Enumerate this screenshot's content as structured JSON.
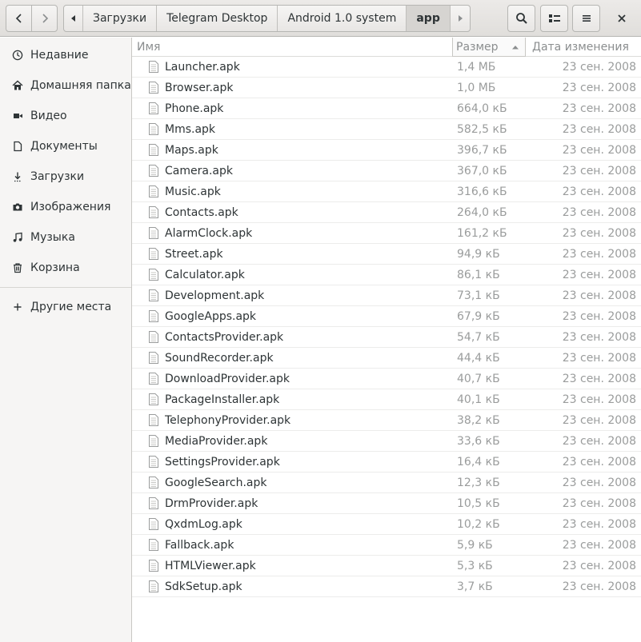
{
  "breadcrumbs": [
    "Загрузки",
    "Telegram Desktop",
    "Android 1.0 system",
    "app"
  ],
  "sidebar": {
    "items": [
      {
        "label": "Недавние",
        "icon": "clock-icon"
      },
      {
        "label": "Домашняя папка",
        "icon": "home-icon"
      },
      {
        "label": "Видео",
        "icon": "video-icon"
      },
      {
        "label": "Документы",
        "icon": "document-icon"
      },
      {
        "label": "Загрузки",
        "icon": "download-icon"
      },
      {
        "label": "Изображения",
        "icon": "camera-icon"
      },
      {
        "label": "Музыка",
        "icon": "music-icon"
      },
      {
        "label": "Корзина",
        "icon": "trash-icon"
      }
    ],
    "other": {
      "label": "Другие места",
      "icon": "plus-icon"
    }
  },
  "columns": {
    "name": "Имя",
    "size": "Размер",
    "date": "Дата изменения"
  },
  "files": [
    {
      "name": "Launcher.apk",
      "size": "1,4 МБ",
      "date": "23 сен. 2008"
    },
    {
      "name": "Browser.apk",
      "size": "1,0 МБ",
      "date": "23 сен. 2008"
    },
    {
      "name": "Phone.apk",
      "size": "664,0 кБ",
      "date": "23 сен. 2008"
    },
    {
      "name": "Mms.apk",
      "size": "582,5 кБ",
      "date": "23 сен. 2008"
    },
    {
      "name": "Maps.apk",
      "size": "396,7 кБ",
      "date": "23 сен. 2008"
    },
    {
      "name": "Camera.apk",
      "size": "367,0 кБ",
      "date": "23 сен. 2008"
    },
    {
      "name": "Music.apk",
      "size": "316,6 кБ",
      "date": "23 сен. 2008"
    },
    {
      "name": "Contacts.apk",
      "size": "264,0 кБ",
      "date": "23 сен. 2008"
    },
    {
      "name": "AlarmClock.apk",
      "size": "161,2 кБ",
      "date": "23 сен. 2008"
    },
    {
      "name": "Street.apk",
      "size": "94,9 кБ",
      "date": "23 сен. 2008"
    },
    {
      "name": "Calculator.apk",
      "size": "86,1 кБ",
      "date": "23 сен. 2008"
    },
    {
      "name": "Development.apk",
      "size": "73,1 кБ",
      "date": "23 сен. 2008"
    },
    {
      "name": "GoogleApps.apk",
      "size": "67,9 кБ",
      "date": "23 сен. 2008"
    },
    {
      "name": "ContactsProvider.apk",
      "size": "54,7 кБ",
      "date": "23 сен. 2008"
    },
    {
      "name": "SoundRecorder.apk",
      "size": "44,4 кБ",
      "date": "23 сен. 2008"
    },
    {
      "name": "DownloadProvider.apk",
      "size": "40,7 кБ",
      "date": "23 сен. 2008"
    },
    {
      "name": "PackageInstaller.apk",
      "size": "40,1 кБ",
      "date": "23 сен. 2008"
    },
    {
      "name": "TelephonyProvider.apk",
      "size": "38,2 кБ",
      "date": "23 сен. 2008"
    },
    {
      "name": "MediaProvider.apk",
      "size": "33,6 кБ",
      "date": "23 сен. 2008"
    },
    {
      "name": "SettingsProvider.apk",
      "size": "16,4 кБ",
      "date": "23 сен. 2008"
    },
    {
      "name": "GoogleSearch.apk",
      "size": "12,3 кБ",
      "date": "23 сен. 2008"
    },
    {
      "name": "DrmProvider.apk",
      "size": "10,5 кБ",
      "date": "23 сен. 2008"
    },
    {
      "name": "QxdmLog.apk",
      "size": "10,2 кБ",
      "date": "23 сен. 2008"
    },
    {
      "name": "Fallback.apk",
      "size": "5,9 кБ",
      "date": "23 сен. 2008"
    },
    {
      "name": "HTMLViewer.apk",
      "size": "5,3 кБ",
      "date": "23 сен. 2008"
    },
    {
      "name": "SdkSetup.apk",
      "size": "3,7 кБ",
      "date": "23 сен. 2008"
    }
  ]
}
